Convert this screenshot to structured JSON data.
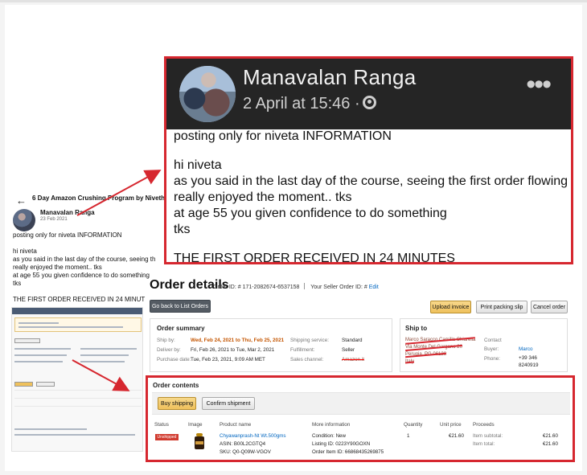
{
  "left_post": {
    "page_title": "6 Day Amazon Crushing Program by Niveth",
    "author": "Manavalan Ranga",
    "date": "23 Feb 2021",
    "lines": [
      "posting only for niveta INFORMATION",
      "hi niveta",
      "as you said in the last day of the course, seeing th",
      "really enjoyed the moment.. tks",
      "at age 55 you given confidence to do something",
      "tks",
      "THE FIRST ORDER RECEIVED IN 24 MINUT"
    ]
  },
  "post": {
    "author": "Manavalan Ranga",
    "date": "2 April at 15:46 ·",
    "more": "•••",
    "lines": [
      "posting only for niveta INFORMATION",
      "hi niveta",
      "as you said in the last day of the course, seeing the first order flowing",
      "really enjoyed the moment.. tks",
      "at age 55 you given confidence to do something",
      "tks",
      "THE FIRST ORDER RECEIVED IN 24 MINUTES"
    ]
  },
  "order": {
    "title": "Order details",
    "order_id_label": "Order ID: # 171-2082674-6537158",
    "seller_order_label": "Your Seller Order ID: #",
    "edit": "Edit",
    "back_button": "Go back to List Orders",
    "upload_invoice": "Upload invoice",
    "print_packing": "Print packing slip",
    "cancel_order": "Cancel order",
    "summary_title": "Order summary",
    "summary": {
      "ship_by_label": "Ship by:",
      "ship_by_value": "Wed, Feb 24, 2021 to Thu, Feb 25, 2021",
      "deliver_by_label": "Deliver by:",
      "deliver_by_value": "Fri, Feb 26, 2021 to Tue, Mar 2, 2021",
      "purchase_label": "Purchase date:",
      "purchase_value": "Tue, Feb 23, 2021, 9:09 AM MET",
      "shipping_label": "Shipping service:",
      "shipping_value": "Standard",
      "fulfillment_label": "Fulfillment:",
      "fulfillment_value": "Seller",
      "channel_label": "Sales channel:",
      "channel_value": "Amazon.it"
    },
    "ship_title": "Ship to",
    "ship_to": [
      "Marco Saracco Camilla Chiarella",
      "Via Monte Del Gargano 20",
      "Perugia, PG 06128",
      "Italy"
    ],
    "contact": {
      "label": "Contact",
      "buyer_label": "Buyer:",
      "buyer_value": "Marco",
      "phone_label": "Phone:",
      "phone_value": "+39 346",
      "phone_value_2": "8240919"
    },
    "contents_title": "Order contents",
    "buy_shipping": "Buy shipping",
    "confirm_shipment": "Confirm shipment",
    "headers": [
      "Status",
      "Image",
      "Product name",
      "More information",
      "Quantity",
      "Unit price",
      "Proceeds"
    ],
    "row": {
      "status": "Unshipped",
      "product": "Chyawanprash-Nt Wt.500gms",
      "asin": "ASIN: B00L2CGTQ4",
      "sku": "SKU: Q0-Q09W-VGOV",
      "condition": "Condition: New",
      "listing": "Listing ID: 0223Y90GOXN",
      "order_item": "Order Item ID: 66868435269875",
      "quantity": "1",
      "unit_price": "€21.60",
      "subtotal_label": "Item subtotal:",
      "subtotal": "€21.60",
      "total_label": "Item total:",
      "total": "€21.60"
    }
  },
  "colors": {
    "highlight": "#d6272f",
    "facebook_header": "#252525",
    "amazon_link": "#0066c0",
    "amazon_orange": "#c45500"
  }
}
